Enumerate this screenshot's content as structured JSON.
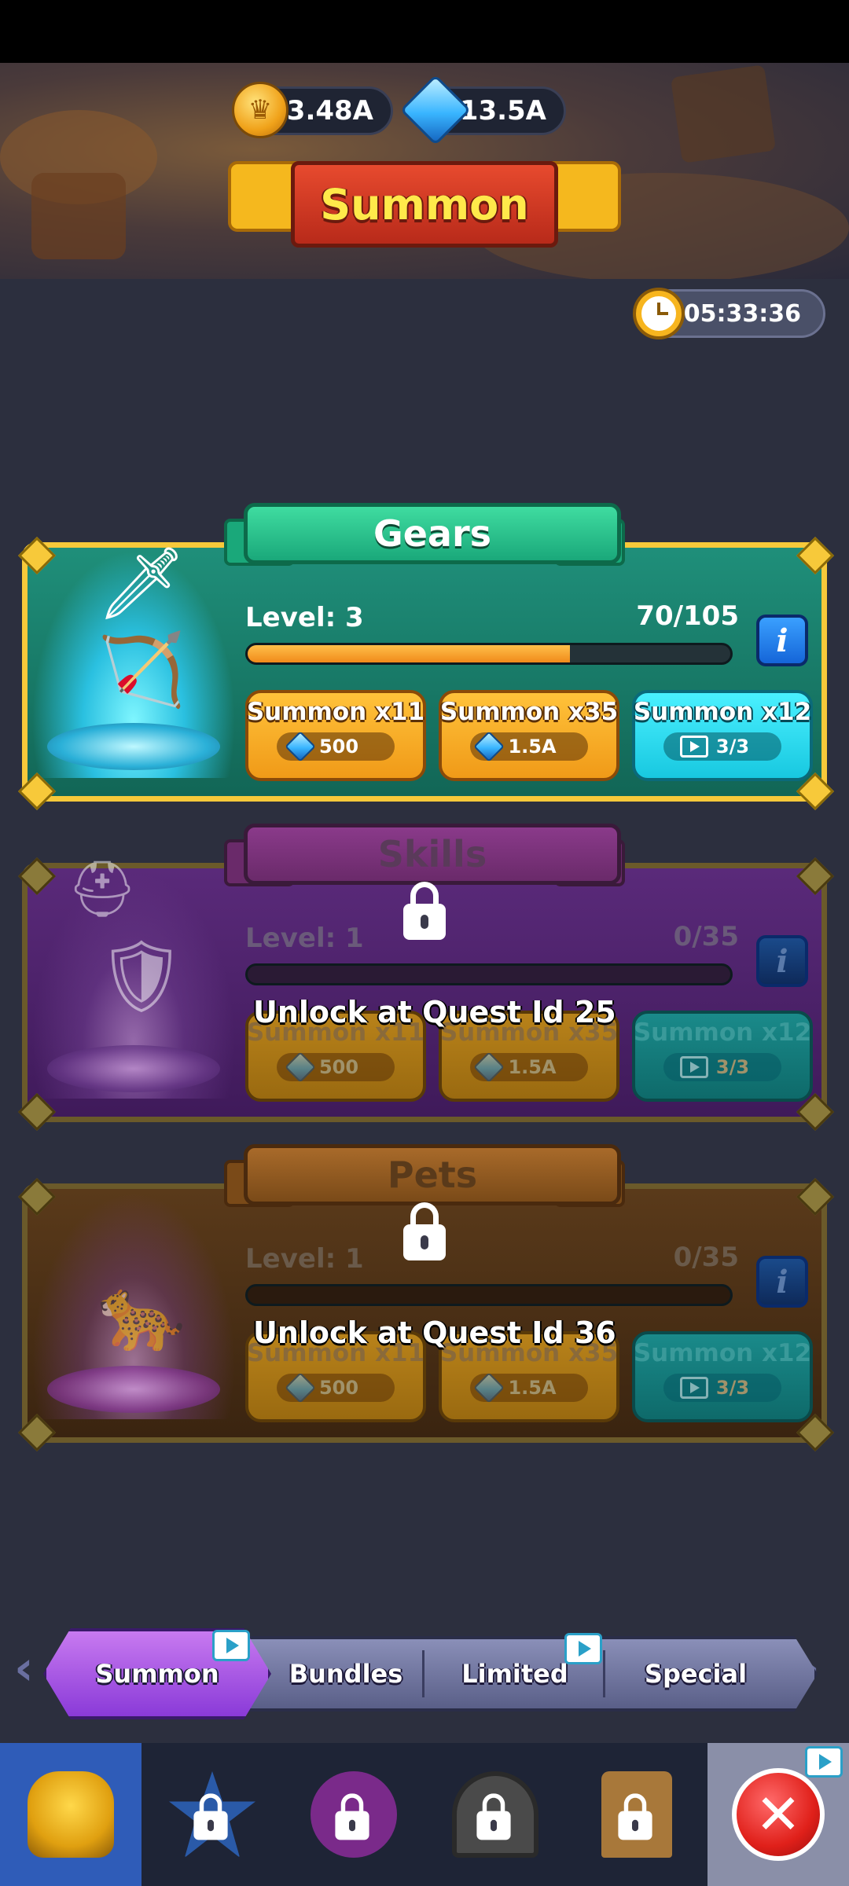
{
  "currency": {
    "gold": "3.48A",
    "gems": "13.5A",
    "gold_icon": "crown-coin-icon",
    "gem_icon": "gem-icon"
  },
  "header": {
    "title": "Summon"
  },
  "timer": {
    "value": "05:33:36",
    "icon": "clock-icon"
  },
  "cards": {
    "gears": {
      "title": "Gears",
      "level": "Level: 3",
      "progress_text": "70/105",
      "progress_fraction": 0.667,
      "info": "i",
      "buttons": [
        {
          "label": "Summon x11",
          "cost": "500",
          "cost_icon": "gem-icon"
        },
        {
          "label": "Summon x35",
          "cost": "1.5A",
          "cost_icon": "gem-icon"
        },
        {
          "label": "Summon x12",
          "cost": "3/3",
          "cost_icon": "video-ad-icon"
        }
      ]
    },
    "skills": {
      "title": "Skills",
      "level": "Level: 1",
      "progress_text": "0/35",
      "progress_fraction": 0,
      "info": "i",
      "locked_message": "Unlock at Quest Id 25",
      "buttons": [
        {
          "label": "Summon x11",
          "cost": "500",
          "cost_icon": "gem-icon"
        },
        {
          "label": "Summon x35",
          "cost": "1.5A",
          "cost_icon": "gem-icon"
        },
        {
          "label": "Summon x12",
          "cost": "3/3",
          "cost_icon": "video-ad-icon"
        }
      ]
    },
    "pets": {
      "title": "Pets",
      "level": "Level: 1",
      "progress_text": "0/35",
      "progress_fraction": 0,
      "info": "i",
      "locked_message": "Unlock at Quest Id 36",
      "buttons": [
        {
          "label": "Summon x11",
          "cost": "500",
          "cost_icon": "gem-icon"
        },
        {
          "label": "Summon x35",
          "cost": "1.5A",
          "cost_icon": "gem-icon"
        },
        {
          "label": "Summon x12",
          "cost": "3/3",
          "cost_icon": "video-ad-icon"
        }
      ]
    }
  },
  "tabs": [
    {
      "label": "Summon",
      "active": true
    },
    {
      "label": "Bundles",
      "active": false
    },
    {
      "label": "Limited",
      "active": false
    },
    {
      "label": "Special",
      "active": false
    }
  ],
  "nav": {
    "items": [
      "helmet-icon",
      "star-locked-icon",
      "paw-locked-icon",
      "gate-locked-icon",
      "tower-locked-icon",
      "close-icon"
    ],
    "close_symbol": "✕"
  },
  "colors": {
    "gears_card": "#1f8f7a",
    "skills_card": "#5a2a7a",
    "pets_card": "#5a3a1a",
    "accent_gold": "#f7c93a",
    "active_tab": "#8a3ad8"
  }
}
